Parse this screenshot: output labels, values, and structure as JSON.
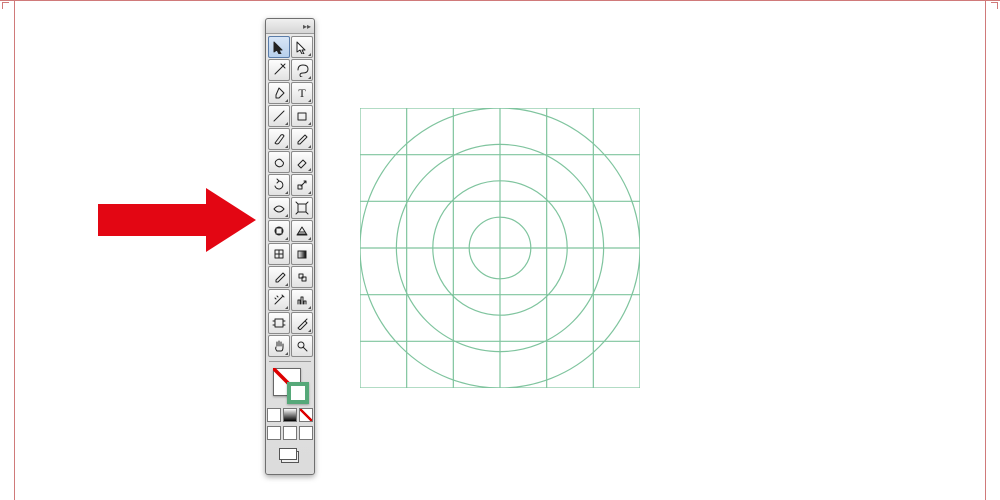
{
  "panel": {
    "header_icon": "collapse-arrows",
    "tools": [
      {
        "name": "selection-tool",
        "flyout": false,
        "selected": true
      },
      {
        "name": "direct-selection-tool",
        "flyout": true,
        "selected": false
      },
      {
        "name": "magic-wand-tool",
        "flyout": false,
        "selected": false
      },
      {
        "name": "lasso-tool",
        "flyout": true,
        "selected": false
      },
      {
        "name": "pen-tool",
        "flyout": true,
        "selected": false
      },
      {
        "name": "type-tool",
        "flyout": true,
        "selected": false
      },
      {
        "name": "line-segment-tool",
        "flyout": true,
        "selected": false
      },
      {
        "name": "rectangle-tool",
        "flyout": true,
        "selected": false
      },
      {
        "name": "paintbrush-tool",
        "flyout": true,
        "selected": false
      },
      {
        "name": "pencil-tool",
        "flyout": true,
        "selected": false
      },
      {
        "name": "blob-brush-tool",
        "flyout": false,
        "selected": false
      },
      {
        "name": "eraser-tool",
        "flyout": true,
        "selected": false
      },
      {
        "name": "rotate-tool",
        "flyout": true,
        "selected": false
      },
      {
        "name": "scale-tool",
        "flyout": true,
        "selected": false
      },
      {
        "name": "width-tool",
        "flyout": true,
        "selected": false
      },
      {
        "name": "free-transform-tool",
        "flyout": false,
        "selected": false
      },
      {
        "name": "shape-builder-tool",
        "flyout": true,
        "selected": false
      },
      {
        "name": "perspective-grid-tool",
        "flyout": true,
        "selected": false
      },
      {
        "name": "mesh-tool",
        "flyout": false,
        "selected": false
      },
      {
        "name": "gradient-tool",
        "flyout": false,
        "selected": false
      },
      {
        "name": "eyedropper-tool",
        "flyout": true,
        "selected": false
      },
      {
        "name": "blend-tool",
        "flyout": false,
        "selected": false
      },
      {
        "name": "symbol-sprayer-tool",
        "flyout": true,
        "selected": false
      },
      {
        "name": "column-graph-tool",
        "flyout": true,
        "selected": false
      },
      {
        "name": "artboard-tool",
        "flyout": false,
        "selected": false
      },
      {
        "name": "slice-tool",
        "flyout": true,
        "selected": false
      },
      {
        "name": "hand-tool",
        "flyout": true,
        "selected": false
      },
      {
        "name": "zoom-tool",
        "flyout": false,
        "selected": false
      }
    ],
    "fill_color": "none",
    "stroke_color": "#56a879",
    "draw_modes": [
      "draw-normal",
      "draw-behind",
      "draw-inside"
    ],
    "color_modes": [
      "color",
      "gradient",
      "none"
    ],
    "screen_mode": "normal"
  },
  "annotation": {
    "arrow_color": "#e30613",
    "arrow_target_tool": "shape-builder-tool"
  },
  "canvas": {
    "stroke_color": "#7fc49e",
    "grid_divisions": 6,
    "circle_radii_ratio": [
      0.5,
      0.37,
      0.24,
      0.11
    ],
    "artboard_size_px": 280
  },
  "document_margins": {
    "color": "#d07a7a"
  }
}
